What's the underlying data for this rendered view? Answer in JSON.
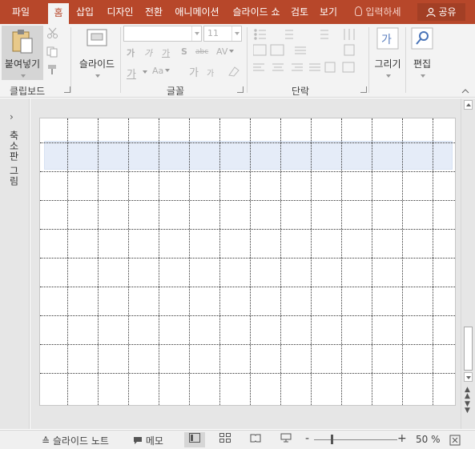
{
  "tabs": [
    {
      "label": "파일",
      "active": false
    },
    {
      "label": "홈",
      "active": true
    },
    {
      "label": "삽입",
      "active": false
    },
    {
      "label": "디자인",
      "active": false
    },
    {
      "label": "전환",
      "active": false
    },
    {
      "label": "애니메이션",
      "active": false
    },
    {
      "label": "슬라이드 쇼",
      "active": false
    },
    {
      "label": "검토",
      "active": false
    },
    {
      "label": "보기",
      "active": false
    }
  ],
  "search": {
    "placeholder": "입력하세"
  },
  "share": {
    "label": "공유"
  },
  "ribbon": {
    "clipboard": {
      "label": "클립보드",
      "paste_label": "붙여넣기"
    },
    "slides": {
      "new_slide_label": "슬라이드"
    },
    "font": {
      "label": "글꼴",
      "font_name": "",
      "font_size": "11",
      "clear_label": "가",
      "case_label": "Aa",
      "bold": "가",
      "italic": "가",
      "underline": "가",
      "shadow": "S",
      "strike": "abc",
      "spacing": "AV",
      "color": "가",
      "grow": "가",
      "shrink": "가"
    },
    "paragraph": {
      "label": "단락"
    },
    "drawing": {
      "label": "그리기"
    },
    "editing": {
      "label": "편집"
    }
  },
  "leftpane": {
    "collapsed_label": "축소판 그림",
    "expand_glyph": "›"
  },
  "statusbar": {
    "notes_label": "슬라이드 노트",
    "comments_label": "메모",
    "zoom_minus": "-",
    "zoom_plus": "+",
    "zoom_value": "50 %",
    "zoom_level": 0.5
  },
  "colors": {
    "accent": "#b7472a",
    "ribbon_bg": "#f3f3f3",
    "work_bg": "#e6e6e6"
  }
}
